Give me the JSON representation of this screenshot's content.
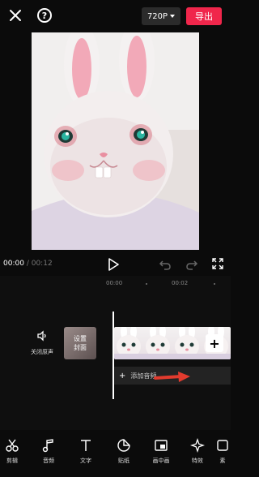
{
  "topbar": {
    "resolution": "720P",
    "export_label": "导出"
  },
  "playback": {
    "current_time": "00:00",
    "separator": "/",
    "duration": "00:12"
  },
  "timeline": {
    "ruler_labels": [
      "00:00",
      "00:02"
    ],
    "mute_label": "关闭原声",
    "cover_label_line1": "设置",
    "cover_label_line2": "封面",
    "audio_track_label": "添加音频",
    "add_clip_label": "+"
  },
  "toolbar": {
    "items": [
      {
        "label": "剪辑",
        "icon": "scissors-icon"
      },
      {
        "label": "音频",
        "icon": "music-note-icon"
      },
      {
        "label": "文字",
        "icon": "text-icon"
      },
      {
        "label": "贴纸",
        "icon": "sticker-icon"
      },
      {
        "label": "画中画",
        "icon": "picture-in-picture-icon"
      },
      {
        "label": "特效",
        "icon": "effects-icon"
      },
      {
        "label": "素",
        "icon": "more-icon"
      }
    ]
  },
  "colors": {
    "export_button": "#f0264b",
    "background": "#0b0b0b",
    "arrow": "#e23b2e"
  }
}
